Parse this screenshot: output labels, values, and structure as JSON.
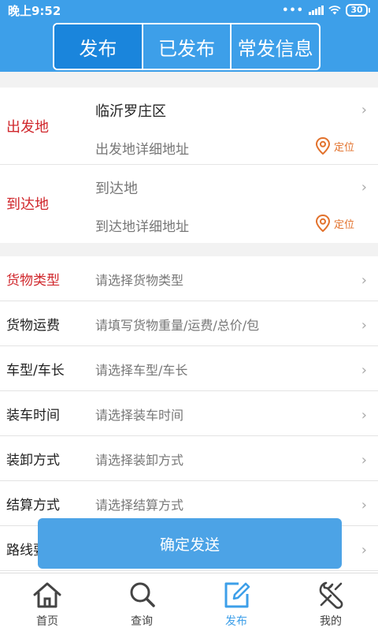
{
  "statusbar": {
    "time": "晚上9:52",
    "battery": "30"
  },
  "tabs": [
    {
      "label": "发布"
    },
    {
      "label": "已发布"
    },
    {
      "label": "常发信息"
    }
  ],
  "origin": {
    "label": "出发地",
    "value": "临沂罗庄区",
    "detail_placeholder": "出发地详细地址",
    "locate_label": "定位"
  },
  "destination": {
    "label": "到达地",
    "value_placeholder": "到达地",
    "detail_placeholder": "到达地详细地址",
    "locate_label": "定位"
  },
  "form_rows": [
    {
      "label": "货物类型",
      "placeholder": "请选择货物类型"
    },
    {
      "label": "货物运费",
      "placeholder": "请填写货物重量/运费/总价/包"
    },
    {
      "label": "车型/车长",
      "placeholder": "请选择车型/车长"
    },
    {
      "label": "装车时间",
      "placeholder": "请选择装车时间"
    },
    {
      "label": "装卸方式",
      "placeholder": "请选择装卸方式"
    },
    {
      "label": "结算方式",
      "placeholder": "请选择结算方式"
    },
    {
      "label": "路线要求",
      "placeholder": ""
    }
  ],
  "submit_label": "确定发送",
  "bottom_nav": [
    {
      "label": "首页",
      "icon": "home-icon"
    },
    {
      "label": "查询",
      "icon": "search-icon"
    },
    {
      "label": "发布",
      "icon": "edit-icon"
    },
    {
      "label": "我的",
      "icon": "wrench-icon"
    }
  ],
  "colors": {
    "accent": "#3d9fe9",
    "required_label": "#d0272c",
    "locate": "#e2712b"
  }
}
